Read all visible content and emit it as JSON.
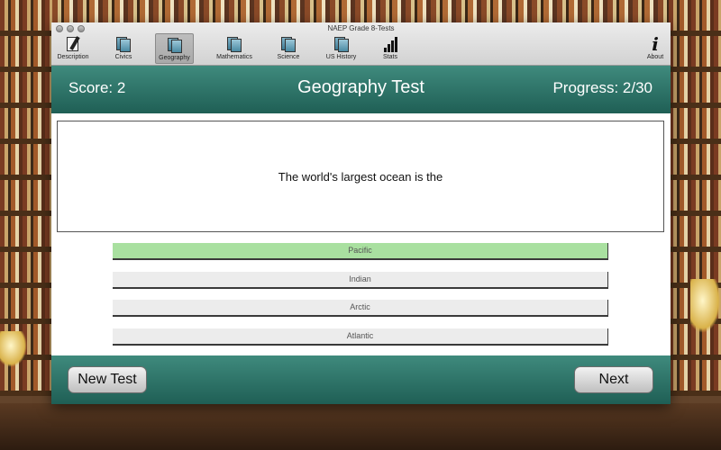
{
  "window": {
    "title": "NAEP Grade 8-Tests"
  },
  "toolbar": {
    "items": [
      {
        "label": "Description",
        "icon": "document-pen-icon"
      },
      {
        "label": "Civics",
        "icon": "book-icon"
      },
      {
        "label": "Geography",
        "icon": "book-icon",
        "active": true
      },
      {
        "label": "Mathematics",
        "icon": "book-icon"
      },
      {
        "label": "Science",
        "icon": "book-icon"
      },
      {
        "label": "US History",
        "icon": "book-icon"
      },
      {
        "label": "Stats",
        "icon": "bar-chart-icon"
      },
      {
        "label": "About",
        "icon": "info-icon",
        "glyph": "i"
      }
    ]
  },
  "header": {
    "score": "Score: 2",
    "title": "Geography Test",
    "progress": "Progress: 2/30"
  },
  "progress": {
    "current": 2,
    "total": 30
  },
  "question": {
    "text": "The world's largest ocean is the"
  },
  "answers": [
    {
      "label": "Pacific",
      "state": "correct"
    },
    {
      "label": "Indian",
      "state": "default"
    },
    {
      "label": "Arctic",
      "state": "default"
    },
    {
      "label": "Atlantic",
      "state": "default"
    }
  ],
  "footer": {
    "new_test_label": "New Test",
    "next_label": "Next"
  },
  "colors": {
    "accent_teal": "#2e7568",
    "correct_answer": "#a9e0a0",
    "answer_default": "#ececec"
  }
}
